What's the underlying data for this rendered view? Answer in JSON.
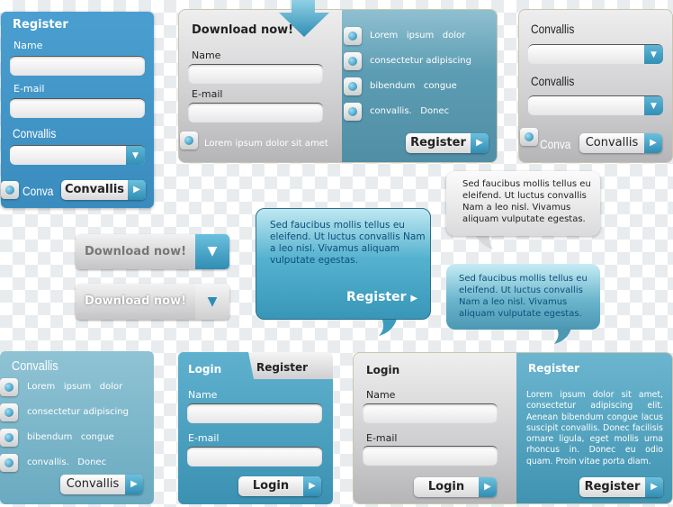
{
  "register_card": {
    "title": "Register",
    "name_label": "Name",
    "email_label": "E-mail",
    "select_label": "Convallis",
    "radio_label": "Conva",
    "button": "Convallis"
  },
  "download_card": {
    "title": "Download now!",
    "name_label": "Name",
    "email_label": "E-mail",
    "check_label": "Lorem ipsum dolor sit amet",
    "options": [
      "Lorem   ipsum   dolor",
      "consectetur adipiscing",
      "bibendum   congue",
      "convallis.   Donec"
    ],
    "button": "Register"
  },
  "select_card": {
    "label1": "Convallis",
    "label2": "Convallis",
    "radio_label": "Conva",
    "button": "Convallis"
  },
  "download_buttons": [
    "Download now!",
    "Download now!"
  ],
  "blue_bubble": {
    "text": "Sed faucibus mollis tellus eu eleifend. Ut luctus convallis Nam a leo nisl. Vivamus aliquam vulputate egestas.",
    "link": "Register"
  },
  "gray_bubble": {
    "text": "Sed faucibus mollis tellus eu eleifend. Ut luctus convallis Nam a leo nisl. Vivamus aliquam vulputate egestas."
  },
  "teal_bubble": {
    "text": "Sed faucibus mollis tellus eu eleifend. Ut luctus convallis Nam a leo nisl. Vivamus aliquam vulputate egestas."
  },
  "list_card": {
    "title": "Convallis",
    "options": [
      "Lorem   ipsum   dolor",
      "consectetur adipiscing",
      "bibendum   congue",
      "convallis.   Donec"
    ],
    "button": "Convallis"
  },
  "tab_card": {
    "tab_login": "Login",
    "tab_register": "Register",
    "name_label": "Name",
    "email_label": "E-mail",
    "button": "Login"
  },
  "split_card": {
    "login_title": "Login",
    "name_label": "Name",
    "email_label": "E-mail",
    "login_button": "Login",
    "register_title": "Register",
    "register_text": "Lorem ipsum dolor sit amet, consectetur adipiscing elit. Aenean bibendum congue lacus suscipit convallis. Donec facilisis ornare ligula, eget mollis urna rhoncus in. Donec eu odio quam. Proin vitae porta diam.",
    "register_button": "Register"
  },
  "icons": {
    "dropdown": "chevron-down-icon",
    "button_arrow": "play-arrow-icon",
    "download": "down-arrow-icon"
  },
  "colors": {
    "blue": "#3f93c4",
    "teal": "#5d9db3",
    "accent": "#2f8db3"
  }
}
